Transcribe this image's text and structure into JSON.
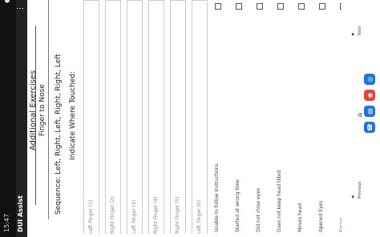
{
  "status": {
    "time": "15:47",
    "icons": "●●"
  },
  "app": {
    "title": "DUI Assist",
    "menu_icon": "menu-icon"
  },
  "screen": {
    "section_title": "Additional Exercises",
    "exercise_name": "Finger to Nose",
    "sequence": "Sequence: Left, Right, Left, Right, Right, Left",
    "indicate": "Indicate Where Touched:"
  },
  "finger_fields": [
    {
      "label": "Left Finger (1)"
    },
    {
      "label": "Right Finger (2)"
    },
    {
      "label": "Left Finger (3)"
    },
    {
      "label": "Right Finger (4)"
    },
    {
      "label": "Right Finger (5)"
    },
    {
      "label": "Left Finger (6)"
    }
  ],
  "checks": [
    {
      "label": "Unable to follow instructions"
    },
    {
      "label": "Started at wrong time"
    },
    {
      "label": "Did not close eyes"
    },
    {
      "label": "Does not keep head tilted"
    },
    {
      "label": "Moves head"
    },
    {
      "label": "Opened Eyes"
    },
    {
      "label": "Sways"
    }
  ],
  "nav": {
    "previous_label": "Previous",
    "next_label": "Next",
    "home_label": "Home"
  },
  "dock": [
    {
      "name": "phone-icon",
      "glyph": "☎",
      "color": "#1a73e8"
    },
    {
      "name": "messages-icon",
      "glyph": "▤",
      "color": "#1a73e8"
    },
    {
      "name": "chrome-icon",
      "glyph": "◉",
      "color": "#ea4335"
    },
    {
      "name": "camera-icon",
      "glyph": "◎",
      "color": "#1a73e8"
    }
  ]
}
